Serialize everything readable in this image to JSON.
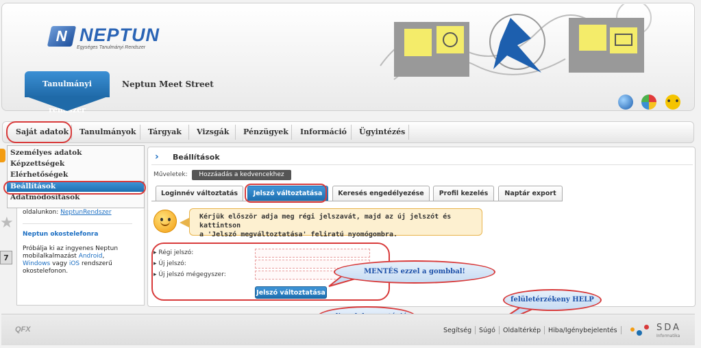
{
  "header": {
    "logo_letter": "N",
    "logo_text": "NEPTUN",
    "logo_subtitle": "Egységes Tanulmányi Rendszer",
    "system_tab": "Tanulmányi rendszer",
    "meet_street": "Neptun Meet Street"
  },
  "menu": {
    "items": [
      "Saját adatok",
      "Tanulmányok",
      "Tárgyak",
      "Vizsgák",
      "Pénzügyek",
      "Információ",
      "Ügyintézés"
    ]
  },
  "dropdown": {
    "items": [
      "Személyes adatok",
      "Képzettségek",
      "Elérhetőségek",
      "Beállítások",
      "Adatmódosítások"
    ]
  },
  "sidebar": {
    "pre_link_text": "oldalunkon:",
    "link": "NeptunRendszer",
    "section_title": "Neptun okostelefonra",
    "line1": "Próbálja ki az ingyenes Neptun",
    "line2": "mobilalkalmazást",
    "android": "Android",
    "line3_comma": ",",
    "windows": "Windows",
    "vagy": "vagy",
    "ios": "iOS",
    "rendszeru": "rendszerű",
    "line4": "okostelefonon."
  },
  "main": {
    "title": "Beállítások",
    "actions_label": "Műveletek:",
    "favorite_button": "Hozzáadás a kedvencekhez",
    "tabs": [
      "Loginnév változtatás",
      "Jelszó változtatása",
      "Keresés engedélyezése",
      "Profil kezelés",
      "Naptár export"
    ],
    "notice_line1": "Kérjük először adja meg régi jelszavát, majd az új jelszót és kattintson",
    "notice_line2": "a 'Jelszó megváltoztatása' feliratú nyomógombra.",
    "fields": [
      "Régi jelszó:",
      "Új jelszó:",
      "Új jelszó mégegyszer:"
    ],
    "submit": "Jelszó változtatása"
  },
  "callouts": {
    "save": "MENTÉS ezzel a gombbal!",
    "help": "felületérzékeny HELP",
    "docs": "online dokumentáció"
  },
  "footer": {
    "qfx": "QFX",
    "links": [
      "Segítség",
      "Súgó",
      "Oldaltérkép",
      "Hiba/Igénybejelentés"
    ],
    "brand": "SDA",
    "brand_sub": "Informatika"
  },
  "colors": {
    "accent": "#1d6fb0",
    "highlight": "#d83a3a",
    "notice_bg": "#fdf0d0"
  }
}
